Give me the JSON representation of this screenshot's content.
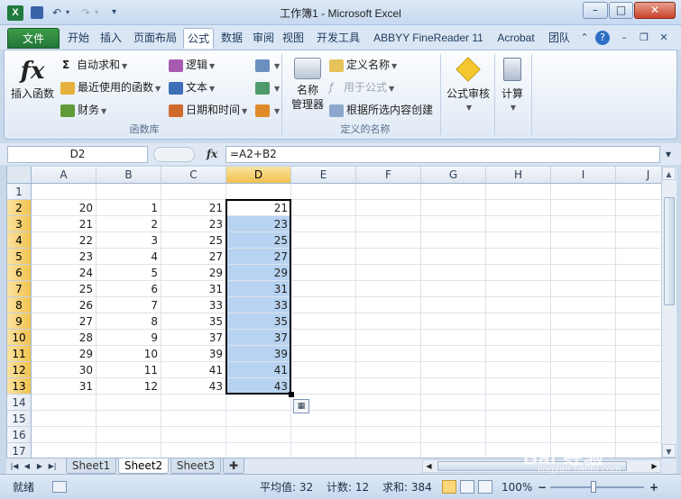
{
  "window": {
    "title": "工作簿1 - Microsoft Excel",
    "app_icon": "X",
    "undo_glyph": "↶",
    "redo_glyph": "↷",
    "qat_more_glyph": "▾",
    "minimize": "–",
    "maximize": "□",
    "close": "✕"
  },
  "ribbon_tabs": [
    {
      "label": "文件"
    },
    {
      "label": "开始"
    },
    {
      "label": "插入"
    },
    {
      "label": "页面布局"
    },
    {
      "label": "公式"
    },
    {
      "label": "数据"
    },
    {
      "label": "审阅"
    },
    {
      "label": "视图"
    },
    {
      "label": "开发工具"
    },
    {
      "label": "ABBYY FineReader 11"
    },
    {
      "label": "Acrobat"
    },
    {
      "label": "团队"
    }
  ],
  "ribbon": {
    "function_library": {
      "group_label": "函数库",
      "insert_function": "插入函数",
      "fx_glyph": "fx",
      "autosum": "自动求和",
      "recent": "最近使用的函数",
      "financial": "财务",
      "logical": "逻辑",
      "text": "文本",
      "datetime": "日期和时间",
      "sigma": "Σ"
    },
    "defined_names": {
      "group_label": "定义的名称",
      "name_manager_line1": "名称",
      "name_manager_line2": "管理器",
      "define_name": "定义名称",
      "use_in_formula": "用于公式",
      "create_from_selection": "根据所选内容创建"
    },
    "formula_auditing": {
      "label": "公式审核"
    },
    "calculation": {
      "label": "计算"
    }
  },
  "formula_bar": {
    "name_box": "D2",
    "fx": "fx",
    "formula": "=A2+B2"
  },
  "columns": [
    "A",
    "B",
    "C",
    "D",
    "E",
    "F",
    "G",
    "H",
    "I",
    "J"
  ],
  "rows": [
    {
      "n": "1",
      "A": "",
      "B": "",
      "C": "",
      "D": ""
    },
    {
      "n": "2",
      "A": "20",
      "B": "1",
      "C": "21",
      "D": "21"
    },
    {
      "n": "3",
      "A": "21",
      "B": "2",
      "C": "23",
      "D": "23"
    },
    {
      "n": "4",
      "A": "22",
      "B": "3",
      "C": "25",
      "D": "25"
    },
    {
      "n": "5",
      "A": "23",
      "B": "4",
      "C": "27",
      "D": "27"
    },
    {
      "n": "6",
      "A": "24",
      "B": "5",
      "C": "29",
      "D": "29"
    },
    {
      "n": "7",
      "A": "25",
      "B": "6",
      "C": "31",
      "D": "31"
    },
    {
      "n": "8",
      "A": "26",
      "B": "7",
      "C": "33",
      "D": "33"
    },
    {
      "n": "9",
      "A": "27",
      "B": "8",
      "C": "35",
      "D": "35"
    },
    {
      "n": "10",
      "A": "28",
      "B": "9",
      "C": "37",
      "D": "37"
    },
    {
      "n": "11",
      "A": "29",
      "B": "10",
      "C": "39",
      "D": "39"
    },
    {
      "n": "12",
      "A": "30",
      "B": "11",
      "C": "41",
      "D": "41"
    },
    {
      "n": "13",
      "A": "31",
      "B": "12",
      "C": "43",
      "D": "43"
    },
    {
      "n": "14",
      "A": "",
      "B": "",
      "C": "",
      "D": ""
    },
    {
      "n": "15",
      "A": "",
      "B": "",
      "C": "",
      "D": ""
    },
    {
      "n": "16",
      "A": "",
      "B": "",
      "C": "",
      "D": ""
    },
    {
      "n": "17",
      "A": "",
      "B": "",
      "C": "",
      "D": ""
    }
  ],
  "selection": {
    "column": "D",
    "first_row": "2",
    "last_row": "13"
  },
  "sheets": [
    {
      "label": "Sheet1",
      "active": false
    },
    {
      "label": "Sheet2",
      "active": true
    },
    {
      "label": "Sheet3",
      "active": false
    }
  ],
  "status": {
    "ready": "就绪",
    "average": "平均值: 32",
    "count": "计数: 12",
    "sum": "求和: 384",
    "zoom": "100%",
    "zoom_minus": "−",
    "zoom_plus": "+"
  },
  "watermark": {
    "text": "Bai 经验",
    "sub": "jingyan.baidu.com"
  },
  "colors": {
    "selection_fill": "#b8d3f1",
    "header_selected": "#f1c24f",
    "file_tab": "#2a8a3e"
  }
}
